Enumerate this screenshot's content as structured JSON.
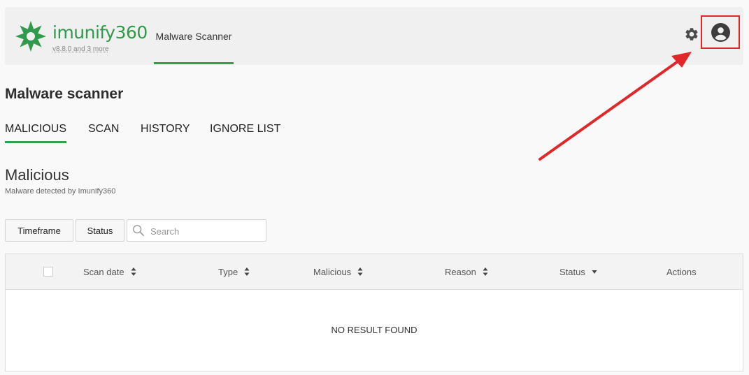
{
  "header": {
    "brand": "imunify360",
    "version": "v8.8.0 and 3 more",
    "nav_tab": "Malware Scanner",
    "settings_icon": "gear-icon",
    "user_icon": "user-avatar-icon"
  },
  "page": {
    "title": "Malware scanner",
    "tabs": [
      "MALICIOUS",
      "SCAN",
      "HISTORY",
      "IGNORE LIST"
    ],
    "active_tab": "MALICIOUS"
  },
  "section": {
    "title": "Malicious",
    "subtitle": "Malware detected by Imunify360"
  },
  "filters": {
    "timeframe_label": "Timeframe",
    "status_label": "Status",
    "search_placeholder": "Search"
  },
  "table": {
    "columns": [
      "Scan date",
      "Type",
      "Malicious",
      "Reason",
      "Status",
      "Actions"
    ],
    "empty_text": "NO RESULT FOUND"
  },
  "colors": {
    "accent": "#2fa24f",
    "highlight": "#e0282a"
  }
}
